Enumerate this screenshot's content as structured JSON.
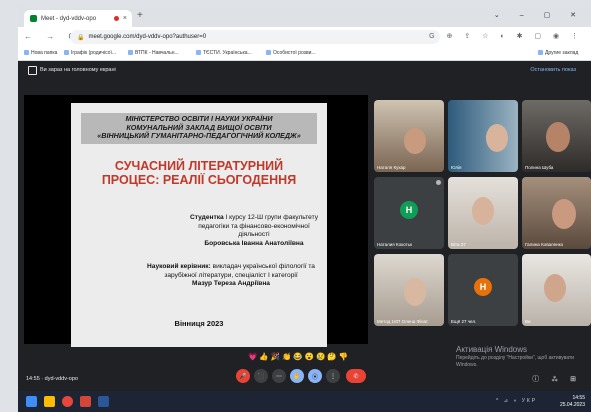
{
  "browser": {
    "tab_title": "Meet - dyd-vddv-opo",
    "close_glyph": "×",
    "new_tab_glyph": "+",
    "window_controls": "⌄ – ▢ ✕",
    "nav_glyphs": "← → C",
    "url": "meet.google.com/dyd-vddv-opo?authuser=0",
    "ext_glyphs": "G ⊕ ⇪ ☆ ◐ ✱ ▢ ◉ ⋮",
    "bookmarks": [
      "Нова папка",
      "Іграфік (родичісої...",
      "ВТПК - Навчальн...",
      "ТЄСТИ. Українська...",
      "Особистої розви..."
    ],
    "bookmarks_other": "Другие заклад"
  },
  "meet": {
    "header_text": "Ви зараз на головному екрані",
    "stop_label": "Остановить показ",
    "time_meeting": "14:55 · dyd-vddv-opo",
    "reactions": "💗👍🎉👏😂😮😢🤔👎",
    "controls": [
      "🎤",
      "⬛",
      "⋯",
      "✋",
      "⦿",
      "⋮",
      "✆"
    ],
    "right_controls": "ⓘ ⁂ ⊞",
    "watermark_title": "Активація Windows",
    "watermark_sub": "Перейдіть до розділу \"Настройки\", щоб активувати Windows."
  },
  "slide": {
    "header_lines": [
      "МІНІСТЕРСТВО ОСВІТИ І НАУКИ УКРАЇНИ",
      "КОМУНАЛЬНИЙ ЗАКЛАД ВИЩОЇ ОСВІТИ",
      "«ВІННИЦЬКИЙ ГУМАНІТАРНО-ПЕДАГОГІЧНИЙ КОЛЕДЖ»"
    ],
    "title_lines": [
      "СУЧАСНИЙ ЛІТЕРАТУРНИЙ",
      "ПРОЦЕС: РЕАЛІЇ СЬОГОДЕННЯ"
    ],
    "student_label": "Студентка",
    "student_info": " I курсу 12-Ш групи факультету педагогіки та фінансово-економічної діяльності",
    "student_name": "Боровська Іванна Анатоліївна",
    "supervisor_label": "Науковий керівник:",
    "supervisor_info": " викладач української філології та зарубіжної літератури, спеціаліст І категорії",
    "supervisor_name": "Мазур Тереза Андріївна",
    "city_year": "Вінниця 2023"
  },
  "participants": [
    {
      "name": "Наталя Кухар",
      "kind": "video"
    },
    {
      "name": "Юлія",
      "kind": "video"
    },
    {
      "name": "Полина Шуба",
      "kind": "video"
    },
    {
      "name": "Наталия Кокотьк",
      "kind": "avatar",
      "initial": "Н",
      "color": "#0f9d58"
    },
    {
      "name": "Віта 37",
      "kind": "video"
    },
    {
      "name": "Галина Коваленко",
      "kind": "video"
    },
    {
      "name": "Метод 1ЄП Олена Філат",
      "kind": "video"
    },
    {
      "name": "Ещё 27 чел.",
      "kind": "more",
      "initial": "Н",
      "color": "#e8710a"
    },
    {
      "name": "Ви",
      "kind": "video"
    }
  ],
  "taskbar": {
    "tray_glyphs": "^ ⊿ ◖ УКР",
    "time": "14:55",
    "date": "25.04.2023"
  },
  "colors": {
    "accent": "#8ab4f8",
    "end_call": "#ea4335",
    "meet_bg": "#202124",
    "slide_title": "#c0392b"
  }
}
